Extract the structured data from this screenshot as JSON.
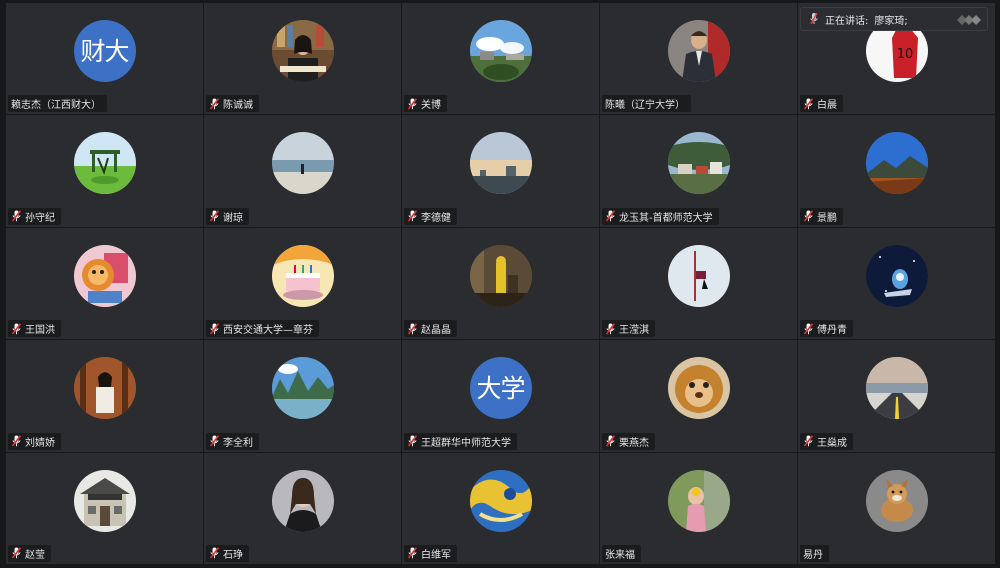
{
  "speaking": {
    "label": "正在讲话:",
    "speaker": "廖家琦;"
  },
  "participants": [
    {
      "name": "赖志杰（江西财大）",
      "mic": false,
      "avatar": "text",
      "avatar_text": "财大"
    },
    {
      "name": "陈诚诚",
      "mic": true,
      "avatar": "photo-person-desk"
    },
    {
      "name": "关博",
      "mic": true,
      "avatar": "photo-landscape-sky"
    },
    {
      "name": "陈曦（辽宁大学）",
      "mic": false,
      "avatar": "photo-man-suit"
    },
    {
      "name": "白晨",
      "mic": true,
      "avatar": "photo-jersey-10"
    },
    {
      "name": "孙守纪",
      "mic": true,
      "avatar": "photo-playground"
    },
    {
      "name": "谢琼",
      "mic": true,
      "avatar": "photo-beach"
    },
    {
      "name": "李德健",
      "mic": true,
      "avatar": "photo-dusk-sky"
    },
    {
      "name": "龙玉其-首都师范大学",
      "mic": true,
      "avatar": "photo-village"
    },
    {
      "name": "景鹏",
      "mic": true,
      "avatar": "photo-mountain"
    },
    {
      "name": "王国洪",
      "mic": true,
      "avatar": "photo-cartoon-lion"
    },
    {
      "name": "西安交通大学—章芬",
      "mic": true,
      "avatar": "photo-cake"
    },
    {
      "name": "赵晶晶",
      "mic": true,
      "avatar": "photo-yellow-figure"
    },
    {
      "name": "王滢淇",
      "mic": true,
      "avatar": "photo-snow-sign"
    },
    {
      "name": "傅丹青",
      "mic": true,
      "avatar": "photo-space"
    },
    {
      "name": "刘婧娇",
      "mic": true,
      "avatar": "photo-woman-forest"
    },
    {
      "name": "李全利",
      "mic": true,
      "avatar": "photo-karst-river"
    },
    {
      "name": "王超群华中师范大学",
      "mic": true,
      "avatar": "text",
      "avatar_text": "大学"
    },
    {
      "name": "栗燕杰",
      "mic": true,
      "avatar": "photo-plush-toy"
    },
    {
      "name": "王燊成",
      "mic": true,
      "avatar": "photo-road-sunset"
    },
    {
      "name": "赵莹",
      "mic": true,
      "avatar": "photo-building"
    },
    {
      "name": "石琤",
      "mic": true,
      "avatar": "photo-woman-portrait"
    },
    {
      "name": "白维军",
      "mic": true,
      "avatar": "photo-blue-painting"
    },
    {
      "name": "张来福",
      "mic": false,
      "avatar": "photo-child-flower"
    },
    {
      "name": "易丹",
      "mic": false,
      "avatar": "photo-dog"
    }
  ]
}
